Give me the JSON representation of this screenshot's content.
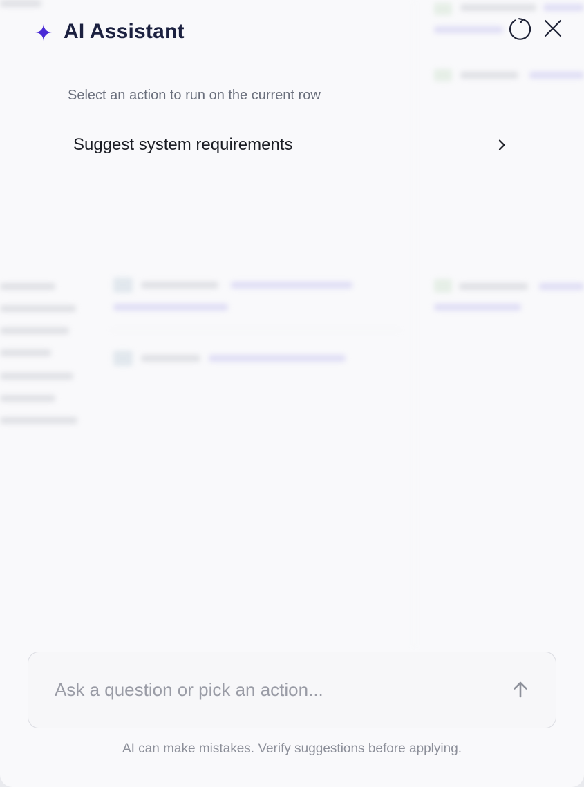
{
  "header": {
    "title": "AI Assistant",
    "icons": {
      "sparkle": "sparkle-icon",
      "refresh": "refresh-icon",
      "close": "close-icon"
    }
  },
  "prompt": {
    "subtitle": "Select an action to run on the current row"
  },
  "actions": [
    {
      "label": "Suggest system requirements",
      "icon": "chevron-right-icon"
    }
  ],
  "composer": {
    "value": "",
    "placeholder": "Ask a question or pick an action...",
    "send_icon": "arrow-up-icon"
  },
  "footer": {
    "disclaimer": "AI can make mistakes. Verify suggestions before applying."
  },
  "colors": {
    "accent": "#4a2bd6",
    "title": "#1c2140",
    "panel_bg": "#f9f9fb"
  }
}
